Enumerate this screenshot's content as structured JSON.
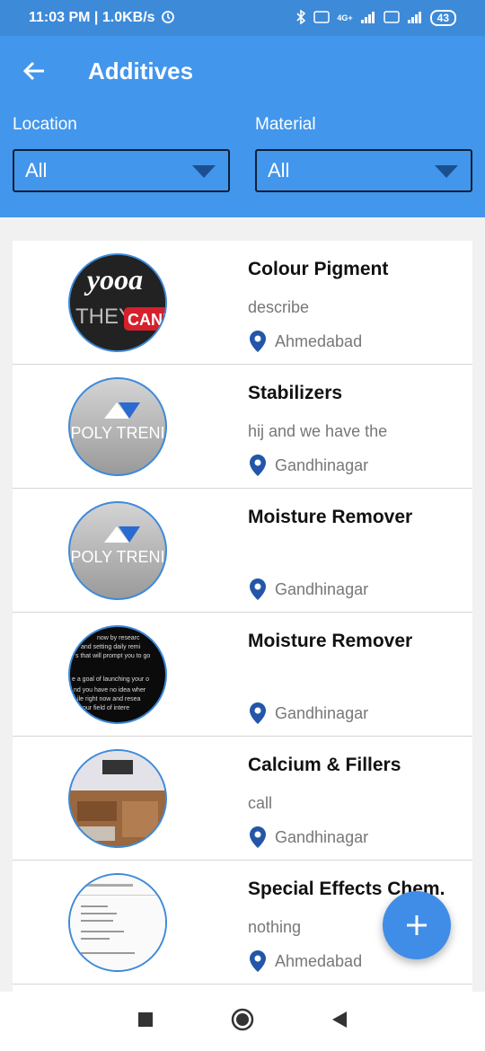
{
  "status": {
    "time_speed": "11:03 PM | 1.0KB/s",
    "network_label": "4G+",
    "battery": "43"
  },
  "appbar": {
    "title": "Additives"
  },
  "filters": {
    "location": {
      "label": "Location",
      "value": "All"
    },
    "material": {
      "label": "Material",
      "value": "All"
    }
  },
  "items": [
    {
      "title": "Colour Pigment",
      "description": "describe",
      "location": "Ahmedabad",
      "thumb": "yooa-they-cant"
    },
    {
      "title": "Stabilizers",
      "description": "hij and we have the",
      "location": "Gandhinagar",
      "thumb": "poly-trend-logo"
    },
    {
      "title": "Moisture Remover",
      "description": "",
      "location": "Gandhinagar",
      "thumb": "poly-trend-logo"
    },
    {
      "title": "Moisture Remover",
      "description": "",
      "location": "Gandhinagar",
      "thumb": "text-on-black"
    },
    {
      "title": "Calcium & Fillers",
      "description": "call",
      "location": "Gandhinagar",
      "thumb": "desk-photo"
    },
    {
      "title": "Special Effects Chem.",
      "description": "nothing",
      "location": "Ahmedabad",
      "thumb": "document-scan"
    }
  ],
  "thumb_text": {
    "yooa": "yooa",
    "they": "THEY",
    "cant": "CAN'",
    "poly": "POLY TRENI",
    "black_lines": [
      "now by researc",
      "and setting daily remi",
      "s that will prompt you to go",
      "e a goal of launching your o",
      "nd you have no idea wher",
      "ile right now and resea",
      "our field of intere"
    ]
  },
  "fab": {
    "icon": "plus-icon"
  },
  "colors": {
    "primary": "#4296ec",
    "status_bar": "#3d8ad9",
    "pin": "#2356a8",
    "fab": "#3f8de6"
  }
}
